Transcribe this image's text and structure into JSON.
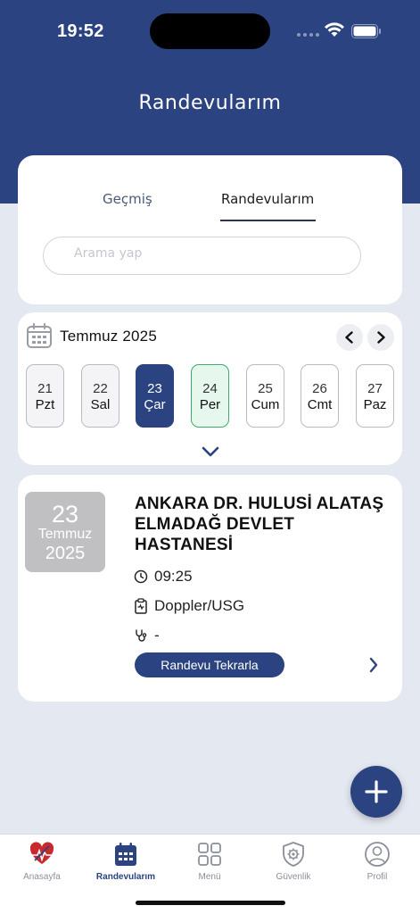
{
  "status_bar": {
    "time": "19:52"
  },
  "header": {
    "title": "Randevularım"
  },
  "tabs": [
    {
      "label": "Geçmiş",
      "active": false
    },
    {
      "label": "Randevularım",
      "active": true
    }
  ],
  "search": {
    "placeholder": "Arama yap",
    "value": ""
  },
  "calendar": {
    "month": "Temmuz 2025",
    "days": [
      {
        "num": "21",
        "name": "Pzt",
        "state": "past"
      },
      {
        "num": "22",
        "name": "Sal",
        "state": "past"
      },
      {
        "num": "23",
        "name": "Çar",
        "state": "selected"
      },
      {
        "num": "24",
        "name": "Per",
        "state": "today"
      },
      {
        "num": "25",
        "name": "Cum",
        "state": "future"
      },
      {
        "num": "26",
        "name": "Cmt",
        "state": "future"
      },
      {
        "num": "27",
        "name": "Paz",
        "state": "future"
      }
    ]
  },
  "appointment": {
    "date_day": "23",
    "date_month": "Temmuz",
    "date_year": "2025",
    "hospital": "ANKARA DR. HULUSİ ALATAŞ ELMADAĞ DEVLET HASTANESİ",
    "time": "09:25",
    "department": "Doppler/USG",
    "doctor": "-",
    "repeat_label": "Randevu Tekrarla"
  },
  "fab_icon": "plus-icon",
  "bottom_nav": [
    {
      "label": "Anasayfa",
      "icon": "heart-logo-icon",
      "active": false
    },
    {
      "label": "Randevularım",
      "icon": "calendar-icon",
      "active": true
    },
    {
      "label": "Menü",
      "icon": "grid-icon",
      "active": false
    },
    {
      "label": "Güvenlik",
      "icon": "shield-gear-icon",
      "active": false
    },
    {
      "label": "Profil",
      "icon": "user-icon",
      "active": false
    }
  ],
  "colors": {
    "primary": "#2b4380",
    "background": "#e4e8f1",
    "today_border": "#3cab6c",
    "badge_gray": "#c0c0c2"
  }
}
